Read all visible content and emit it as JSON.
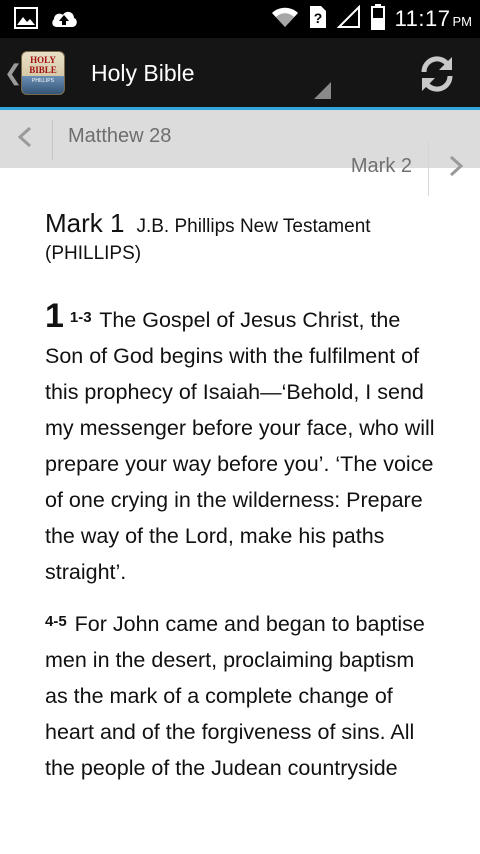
{
  "status_bar": {
    "time": "11:17",
    "ampm": "PM",
    "icons": [
      "gallery-icon",
      "cloud-upload-icon",
      "wifi-icon",
      "unknown-sim-icon",
      "signal-icon",
      "battery-icon"
    ]
  },
  "app_bar": {
    "title": "Holy Bible",
    "icon_text_line1": "HOLY",
    "icon_text_line2": "BIBLE",
    "icon_text_line3": "PHILLIPS"
  },
  "nav": {
    "prev_label": "Matthew 28",
    "next_label": "Mark 2"
  },
  "passage": {
    "chapter_title": "Mark 1",
    "version": "J.B. Phillips New Testament (PHILLIPS)",
    "chapter_number": "1",
    "verses": [
      {
        "ref": "1-3",
        "text": "The Gospel of Jesus Christ, the Son of God begins with the fulfilment of this prophecy of Isaiah—‘Behold, I send my messenger before your face, who will prepare your way before you’. ‘The voice of one crying in the wilderness: Prepare the way of the Lord, make his paths straight’."
      },
      {
        "ref": "4-5",
        "text": "For John came and began to baptise men in the desert, proclaiming baptism as the mark of a complete change of heart and of the forgiveness of sins. All the people of the Judean countryside"
      }
    ]
  },
  "colors": {
    "status_bar_bg": "#000000",
    "app_bar_bg": "#151515",
    "accent": "#33a5dd",
    "nav_bar_bg": "#dcdcdc"
  }
}
